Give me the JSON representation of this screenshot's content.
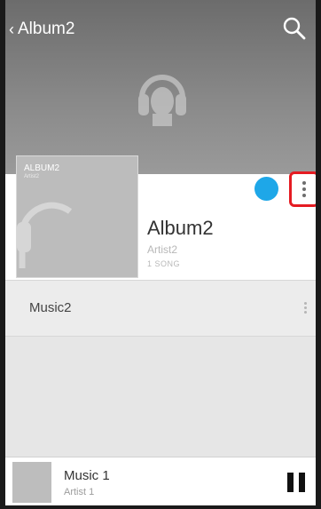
{
  "header": {
    "back_label": "Album2",
    "back_icon": "chevron-left-icon",
    "search_icon": "search-icon"
  },
  "cover": {
    "title": "ALBUM2",
    "subtitle": "Artist2"
  },
  "album": {
    "title": "Album2",
    "artist": "Artist2",
    "song_count": "1 SONG"
  },
  "actions": {
    "play_color": "#1ea7e8",
    "highlight_color": "#e51b22"
  },
  "songs": [
    {
      "title": "Music2"
    }
  ],
  "player": {
    "title": "Music 1",
    "artist": "Artist 1",
    "control": "pause-icon"
  }
}
